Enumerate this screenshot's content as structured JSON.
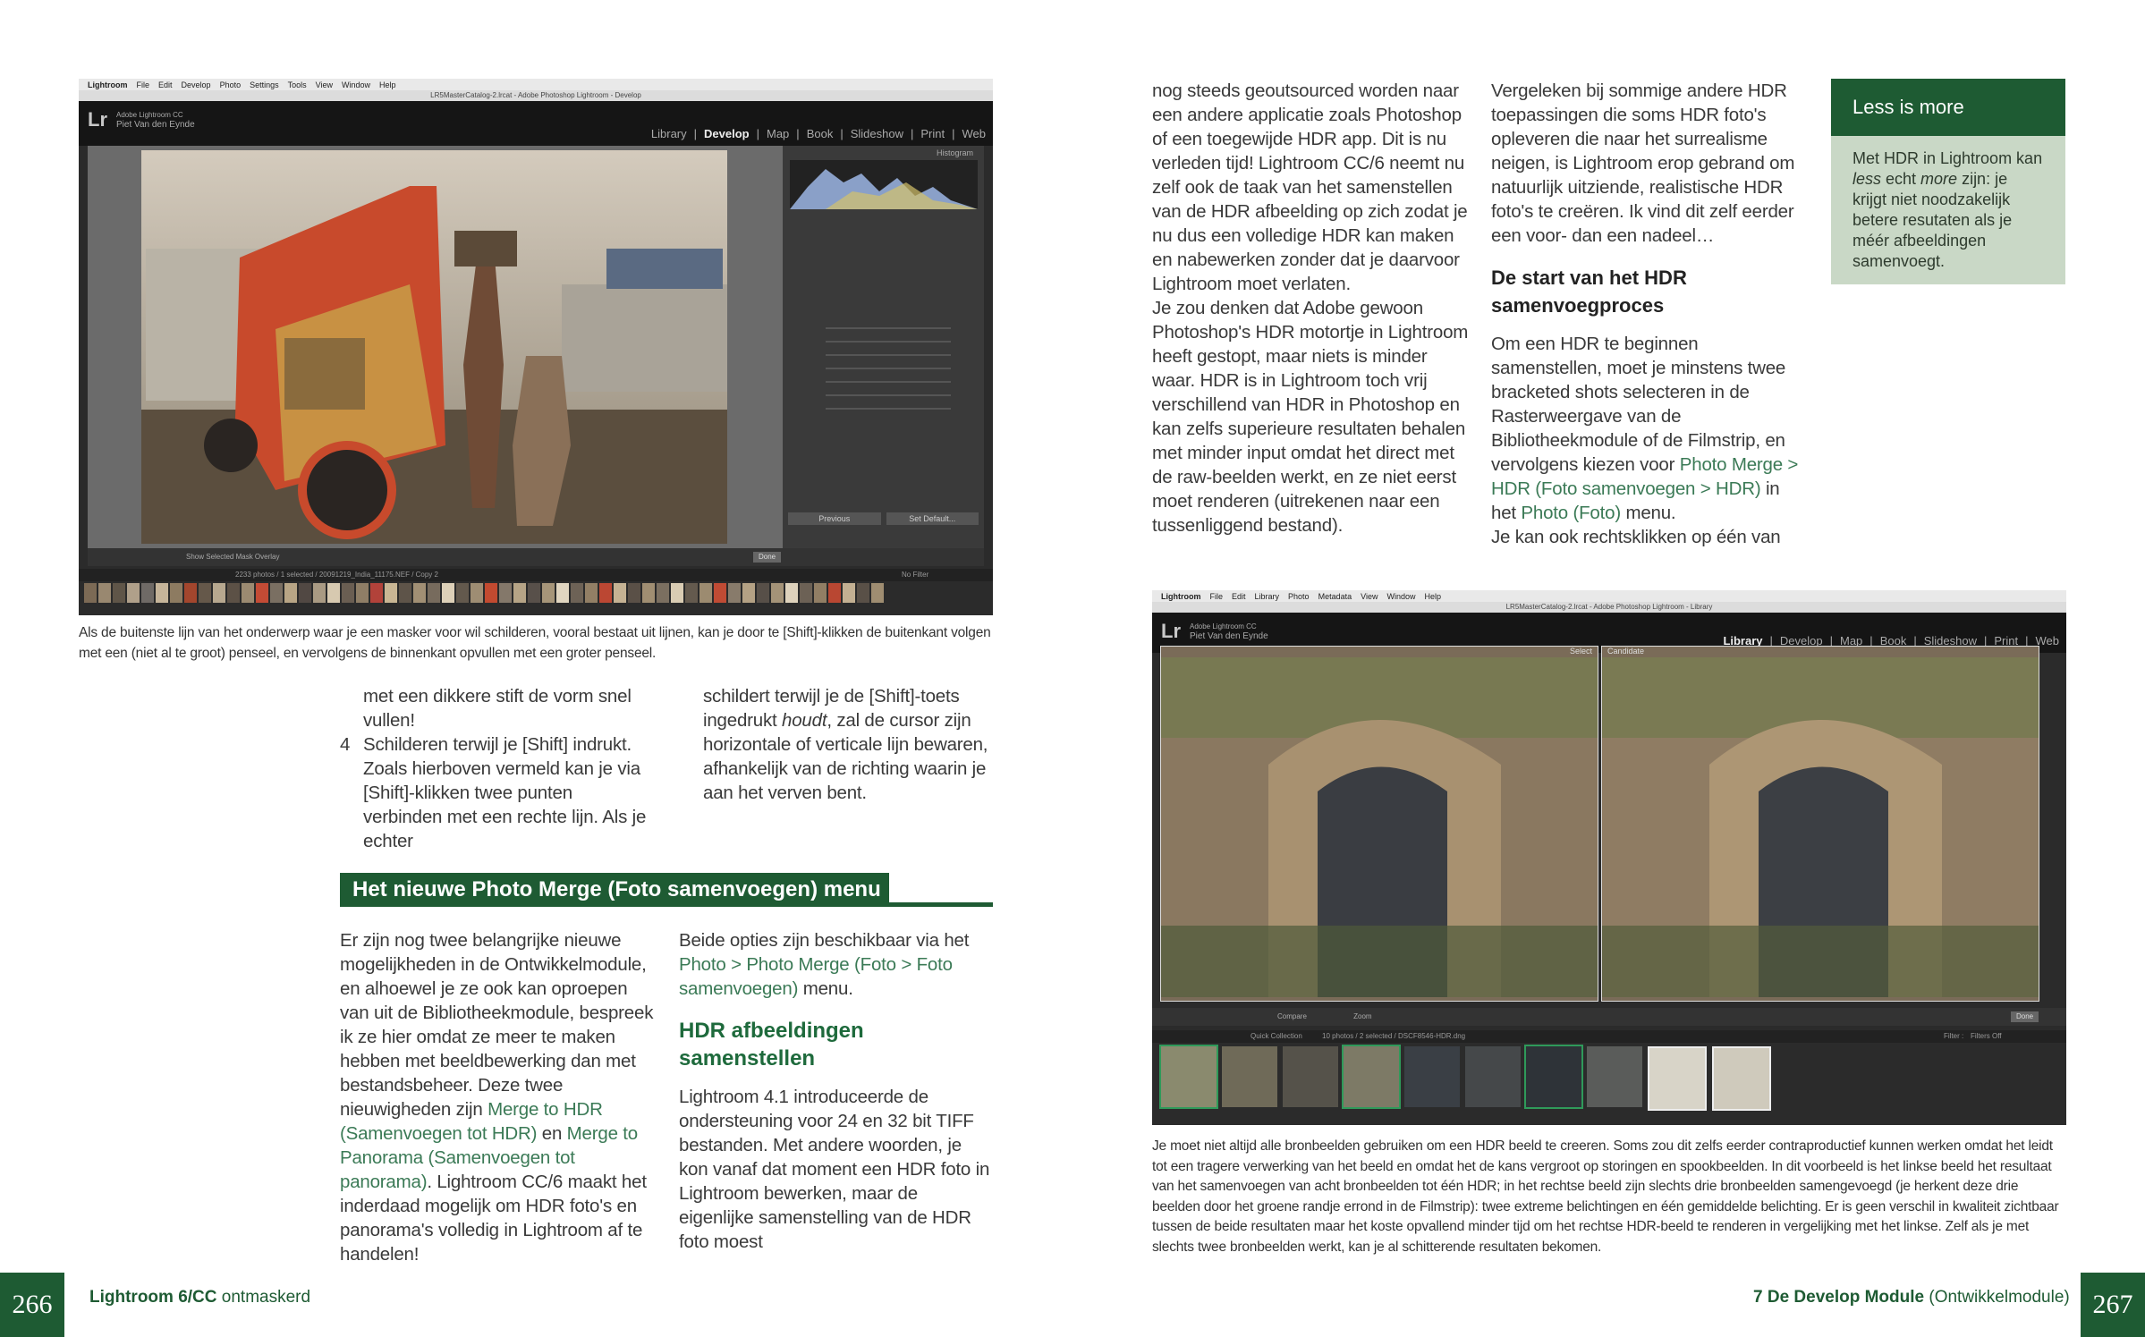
{
  "left_page": {
    "screenshot1": {
      "menubar": [
        "Lightroom",
        "File",
        "Edit",
        "Develop",
        "Photo",
        "Settings",
        "Tools",
        "View",
        "Window",
        "Help"
      ],
      "titlebar": "LR5MasterCatalog-2.lrcat - Adobe Photoshop Lightroom - Develop",
      "brand": "Adobe Lightroom CC",
      "user": "Piet Van den Eynde",
      "modules": [
        "Library",
        "Develop",
        "Map",
        "Book",
        "Slideshow",
        "Print",
        "Web"
      ],
      "active_module": "Develop",
      "panel_header": "Histogram",
      "toolbar_text": "Show Selected Mask Overlay",
      "btn_previous": "Previous",
      "btn_reset": "Set Default...",
      "btn_done": "Done",
      "path_text": "2233 photos / 1 selected / 20091219_India_11175.NEF / Copy 2",
      "filter_text": "No Filter"
    },
    "caption1": "Als de buitenste lijn van het onderwerp waar je een masker voor wil schilderen, vooral bestaat uit lijnen, kan je door te [Shift]-klikken de buitenkant volgen met een (niet al te groot) penseel, en vervolgens de binnenkant opvullen met een groter penseel.",
    "col1_text": "met een dikkere stift de vorm snel vullen!",
    "list_num": "4",
    "list_text": "Schilderen terwijl je [Shift] indrukt. Zoals hierboven vermeld kan je via [Shift]-klikken twee punten verbinden met een rechte lijn. Als je echter",
    "col2_a": "schildert terwijl je de [Shift]-toets ingedrukt ",
    "col2_em": "houdt",
    "col2_b": ", zal de cursor zijn horizontale of verticale lijn bewaren, afhankelijk van de richting waarin je aan het verven bent.",
    "section_heading": "Het nieuwe Photo Merge (Foto samenvoegen) menu",
    "p1_a": "Er zijn nog twee belangrijke nieuwe mogelijkheden in de Ontwikkelmodule, en alhoewel je ze ook kan oproepen van uit de Bibliotheekmodule, bespreek ik ze hier omdat ze meer te maken hebben met beeldbewerking dan met bestandsbeheer. Deze twee nieuwigheden zijn ",
    "p1_link1": "Merge to HDR (Samenvoegen tot HDR)",
    "p1_b": " en ",
    "p1_link2": "Merge to Panorama (Samenvoegen tot panorama)",
    "p1_c": ". Lightroom CC/6 maakt het inderdaad mogelijk om HDR foto's en panorama's volledig in Lightroom af te handelen!",
    "p2_a": "Beide opties zijn beschikbaar via het ",
    "p2_link": "Photo > Photo Merge (Foto > Foto samenvoegen)",
    "p2_b": " menu.",
    "subhead": "HDR afbeeldingen samenstellen",
    "p3": "Lightroom 4.1 introduceerde de ondersteuning voor 24 en 32 bit TIFF bestanden. Met andere woorden, je kon vanaf dat moment een HDR foto in Lightroom bewerken, maar de eigenlijke samenstelling van de HDR foto moest",
    "page_number": "266",
    "footer_bold": "Lightroom 6/CC",
    "footer_rest": " ontmaskerd"
  },
  "right_page": {
    "col1": "nog steeds geoutsourced worden naar een andere applicatie zoals Photoshop of een toegewijde HDR app. Dit is nu verleden tijd! Lightroom CC/6 neemt nu zelf ook de taak van het samenstellen van de HDR afbeelding op zich zodat je nu dus een volledige HDR kan maken en nabewerken zonder dat je daarvoor Lightroom moet verlaten.",
    "col1_b": "Je zou denken dat Adobe gewoon Photoshop's HDR motortje in Lightroom heeft gestopt, maar niets is minder waar. HDR is in Lightroom toch vrij verschillend van HDR in Photoshop en kan zelfs superieure resultaten behalen met minder input omdat het direct met de raw-beelden werkt, en ze niet eerst moet renderen (uitrekenen naar een tussenliggend bestand).",
    "col2": "Vergeleken bij sommige andere HDR toepassingen die soms HDR foto's opleveren die naar het surrealisme neigen, is Lightroom erop gebrand om natuurlijk uitziende, realistische HDR foto's te creëren. Ik vind dit zelf eerder een voor- dan een nadeel…",
    "subhead": "De start van het HDR samenvoegproces",
    "col2_b_a": "Om een HDR te beginnen samenstellen, moet je minstens twee bracketed shots selecteren in de Rasterweergave van de Bibliotheekmodule of de Filmstrip, en vervolgens kiezen voor ",
    "col2_b_link1": "Photo Merge > HDR (Foto samenvoegen > HDR)",
    "col2_b_b": " in het ",
    "col2_b_link2": "Photo (Foto)",
    "col2_b_c": " menu.",
    "col2_c": "Je kan ook rechtsklikken op één van",
    "box_title": "Less is more",
    "box_a": "Met HDR in Lightroom kan ",
    "box_em1": "less",
    "box_b": " echt ",
    "box_em2": "more",
    "box_c": " zijn: je krijgt niet noodzakelijk betere resutaten als je méér afbeeldingen samenvoegt.",
    "screenshot2": {
      "menubar": [
        "Lightroom",
        "File",
        "Edit",
        "Library",
        "Photo",
        "Metadata",
        "View",
        "Window",
        "Help"
      ],
      "titlebar": "LR5MasterCatalog-2.lrcat - Adobe Photoshop Lightroom - Library",
      "brand": "Adobe Lightroom CC",
      "user": "Piet Van den Eynde",
      "modules": [
        "Library",
        "Develop",
        "Map",
        "Book",
        "Slideshow",
        "Print",
        "Web"
      ],
      "active_module": "Library",
      "label_select": "Select",
      "label_candidate": "Candidate",
      "compare": "Compare",
      "zoom": "Zoom",
      "btn_done": "Done",
      "collection": "Quick Collection",
      "path_text": "10 photos / 2 selected / DSCF8546-HDR.dng",
      "filter_label": "Filter :",
      "filter_value": "Filters Off"
    },
    "caption2": "Je moet niet altijd alle bronbeelden gebruiken om een HDR beeld te creeren. Soms zou dit zelfs eerder contraproductief kunnen werken omdat het leidt tot een tragere verwerking van het beeld en omdat het de kans vergroot op storingen en spookbeelden. In dit voorbeeld is het linkse beeld het resultaat van het samenvoegen van acht bronbeelden tot één HDR; in het rechtse beeld zijn slechts drie bronbeelden samengevoegd (je herkent deze drie beelden door het groene randje errond in de Filmstrip): twee extreme belichtingen en één gemiddelde belichting. Er is geen verschil in kwaliteit zichtbaar tussen de beide resultaten maar het koste opvallend minder tijd om het rechtse HDR-beeld te renderen in vergelijking met het linkse. Zelf als je met slechts twee bronbeelden werkt, kan je al schitterende resultaten bekomen.",
    "footer_bold": "7  De Develop Module",
    "footer_rest": "  (Ontwikkelmodule)",
    "page_number": "267"
  },
  "colors": {
    "brand_green": "#1e5b33",
    "link_green": "#3b7a56",
    "box_bg": "#c9d8c6"
  }
}
